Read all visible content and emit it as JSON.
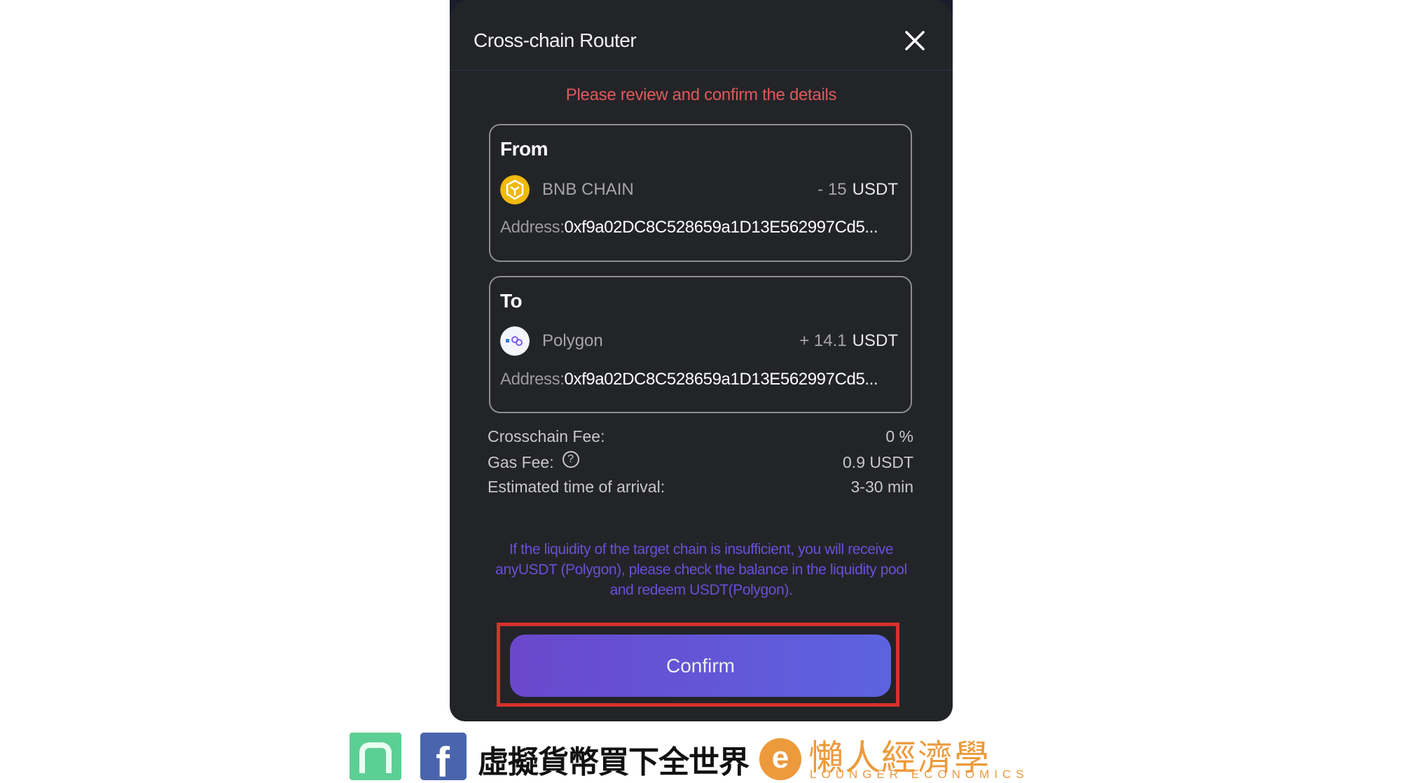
{
  "modal": {
    "title": "Cross-chain Router",
    "warning": "Please review and confirm the details",
    "from": {
      "label": "From",
      "chain": "BNB CHAIN",
      "amount": "- 15",
      "unit": "USDT",
      "address_label": "Address:",
      "address": "0xf9a02DC8C528659a1D13E562997Cd5..."
    },
    "to": {
      "label": "To",
      "chain": "Polygon",
      "amount": "+ 14.1",
      "unit": "USDT",
      "address_label": "Address:",
      "address": "0xf9a02DC8C528659a1D13E562997Cd5..."
    },
    "fees": [
      {
        "label": "Crosschain Fee:",
        "value": "0 %"
      },
      {
        "label": "Gas Fee:",
        "value": "0.9 USDT"
      },
      {
        "label": "Estimated time of arrival:",
        "value": "3-30 min"
      }
    ],
    "note": "If the liquidity of the target chain is insufficient, you will receive anyUSDT (Polygon), please check the balance in the liquidity pool and redeem USDT(Polygon).",
    "confirm_label": "Confirm"
  },
  "footer": {
    "slogan": "虛擬貨幣買下全世界",
    "brand_zh": "懶人經濟學",
    "brand_en": "LOUNGER ECONOMICS"
  },
  "colors": {
    "accent": "#6a4fd8",
    "warning": "#e0585b",
    "highlight": "#d8312c"
  }
}
